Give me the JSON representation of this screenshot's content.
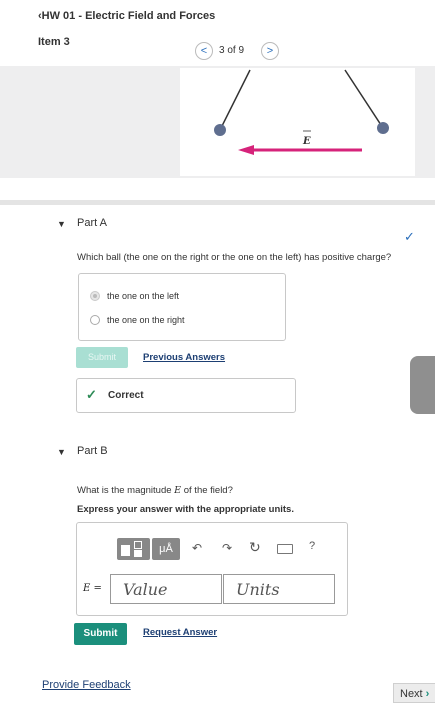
{
  "header": {
    "back_title": "HW 01 - Electric Field and Forces",
    "item_label": "Item 3",
    "pager": {
      "prev": "<",
      "position": "3 of 9",
      "next": ">"
    }
  },
  "figure": {
    "field_label": "E"
  },
  "part_a": {
    "title": "Part A",
    "question": "Which ball (the one on the right or the one on the left) has positive charge?",
    "choices": [
      {
        "label": "the one on the left",
        "selected": true
      },
      {
        "label": "the one on the right",
        "selected": false
      }
    ],
    "submit_label": "Submit",
    "previous_answers_label": "Previous Answers",
    "result_label": "Correct"
  },
  "part_b": {
    "title": "Part B",
    "question_pre": "What is the magnitude ",
    "question_symbol": "E",
    "question_post": " of the field?",
    "instruction": "Express your answer with the appropriate units.",
    "toolbar": {
      "units_symbol": "μÅ",
      "help": "?"
    },
    "variable_label": "E =",
    "value_placeholder": "Value",
    "units_placeholder": "Units",
    "submit_label": "Submit",
    "request_answer_label": "Request Answer"
  },
  "footer": {
    "feedback_label": "Provide Feedback",
    "next_label": "Next"
  },
  "colors": {
    "accent_teal": "#1b8f7c",
    "correct_green": "#2e8b57",
    "arrow_magenta": "#d6237a",
    "ball_slate": "#5f6e8f"
  }
}
